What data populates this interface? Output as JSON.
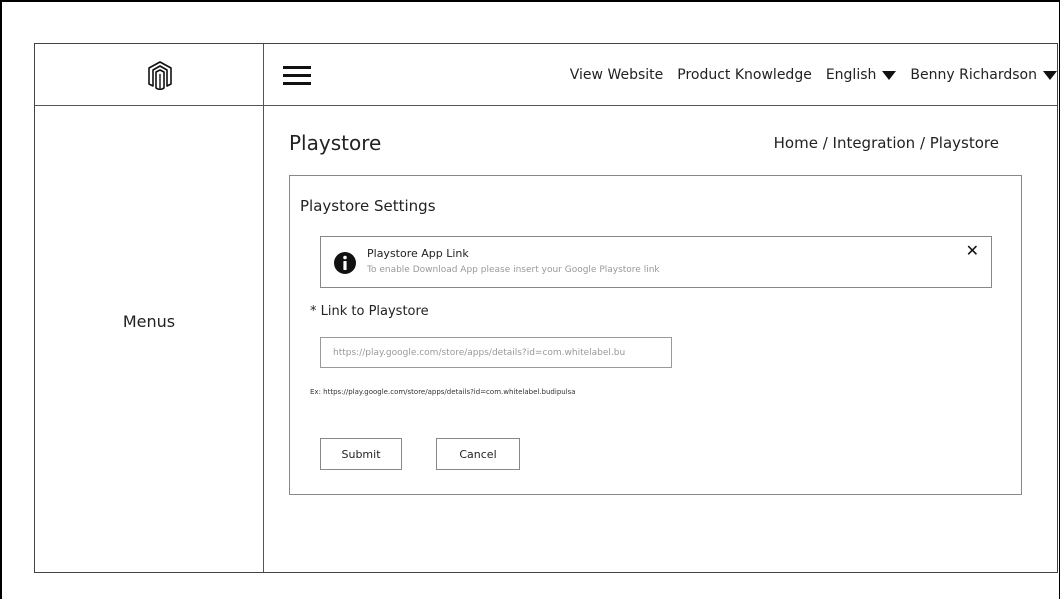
{
  "header": {
    "logo_icon": "magento-logo-icon",
    "menu_icon": "hamburger-icon",
    "nav": {
      "view_website": "View Website",
      "product_knowledge": "Product Knowledge",
      "language": "English",
      "user": "Benny Richardson"
    }
  },
  "sidebar": {
    "label": "Menus"
  },
  "page": {
    "title": "Playstore",
    "breadcrumb": [
      "Home",
      "Integration",
      "Playstore"
    ],
    "breadcrumb_separator": " / "
  },
  "card": {
    "title": "Playstore Settings",
    "alert": {
      "icon": "info-icon",
      "title": "Playstore App Link",
      "message": "To enable Download App please insert your Google Playstore link",
      "close": "✕"
    },
    "field_label": "* Link to Playstore",
    "input": {
      "value": "",
      "placeholder": "https://play.google.com/store/apps/details?id=com.whitelabel.bu"
    },
    "example": "Ex: https://play.google.com/store/apps/details?id=com.whitelabel.budipulsa",
    "buttons": {
      "submit": "Submit",
      "cancel": "Cancel"
    }
  }
}
